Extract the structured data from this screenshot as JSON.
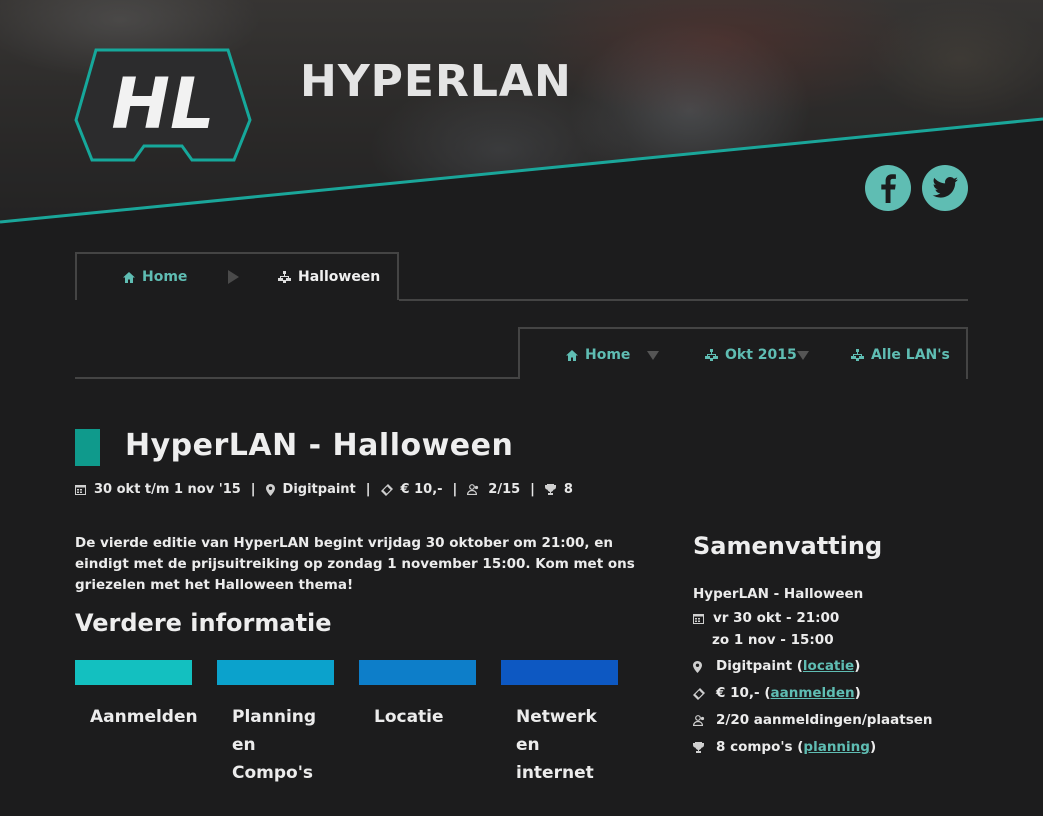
{
  "header": {
    "brand": "HYPERLAN",
    "logo_text": "HL",
    "social": [
      "facebook-icon",
      "twitter-icon"
    ]
  },
  "breadcrumb": {
    "home": "Home",
    "current": "Halloween"
  },
  "nav": {
    "home": "Home",
    "month": "Okt 2015",
    "all": "Alle LAN's"
  },
  "event": {
    "title": "HyperLAN - Halloween",
    "dates": "30 okt t/m 1 nov '15",
    "location": "Digitpaint",
    "price": "€ 10,-",
    "attendees": "2/15",
    "compos": "8",
    "description": "De vierde editie van HyperLAN begint vrijdag 30 oktober om 21:00, en eindigt met de prijsuitreiking op zondag 1 november 15:00. Kom met ons griezelen met het Halloween thema!"
  },
  "more_info": {
    "heading": "Verdere informatie",
    "tiles": [
      {
        "label": "Aanmelden",
        "color": "#13c0c0"
      },
      {
        "label": "Planning en Compo's",
        "color": "#0ba2cc"
      },
      {
        "label": "Locatie",
        "color": "#0d7ec9"
      },
      {
        "label": "Netwerk en internet",
        "color": "#0d58c2"
      }
    ]
  },
  "summary": {
    "heading": "Samenvatting",
    "name": "HyperLAN - Halloween",
    "start": "vr 30 okt - 21:00",
    "end": "zo 1 nov - 15:00",
    "location": "Digitpaint",
    "location_link": "locatie",
    "price": "€ 10,-",
    "price_link": "aanmelden",
    "registrations": "2/20 aanmeldingen/plaatsen",
    "compos": "8 compo's",
    "compos_link": "planning"
  },
  "colors": {
    "accent": "#5fbdb3",
    "title_bar": "#0f9a8c",
    "background": "#1c1c1d"
  }
}
